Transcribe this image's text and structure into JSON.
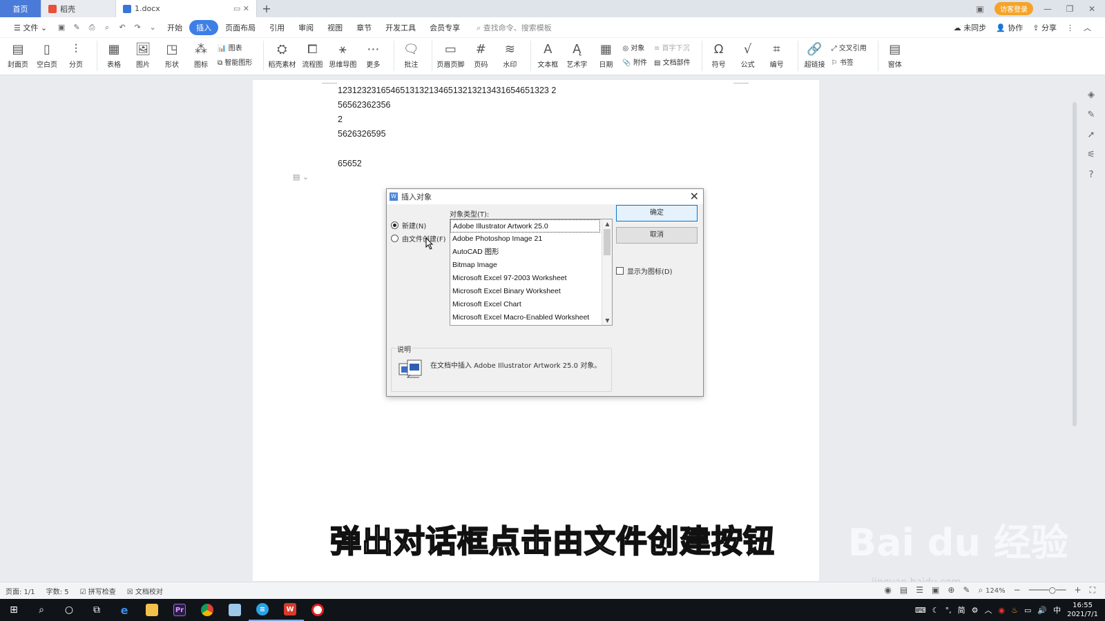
{
  "tabs": {
    "home": "首页",
    "straw": "稻壳",
    "doc": "1.docx"
  },
  "top_right": {
    "guest": "访客登录"
  },
  "menu": {
    "file": "文件",
    "items": [
      "开始",
      "插入",
      "页面布局",
      "引用",
      "审阅",
      "视图",
      "章节",
      "开发工具",
      "会员专享"
    ],
    "active": "插入",
    "search": "查找命令、搜索模板",
    "sync": "未同步",
    "collab": "协作",
    "share": "分享"
  },
  "ribbon": {
    "groups": [
      {
        "name": "cover",
        "label": "封面页"
      },
      {
        "name": "blank",
        "label": "空白页"
      },
      {
        "name": "break",
        "label": "分页"
      },
      {
        "name": "table",
        "label": "表格"
      },
      {
        "name": "picture",
        "label": "图片"
      },
      {
        "name": "shape",
        "label": "形状"
      },
      {
        "name": "icons",
        "label": "图标"
      }
    ],
    "chart": "图表",
    "smartart": "智能图形",
    "groups2": [
      {
        "name": "straw-material",
        "label": "稻壳素材"
      },
      {
        "name": "flowchart",
        "label": "流程图"
      },
      {
        "name": "mindmap",
        "label": "思维导图"
      },
      {
        "name": "more",
        "label": "更多"
      },
      {
        "name": "comment",
        "label": "批注"
      },
      {
        "name": "header-footer",
        "label": "页眉页脚"
      },
      {
        "name": "page-number",
        "label": "页码"
      },
      {
        "name": "watermark",
        "label": "水印"
      },
      {
        "name": "textbox",
        "label": "文本框"
      },
      {
        "name": "wordart",
        "label": "艺术字"
      },
      {
        "name": "date",
        "label": "日期"
      }
    ],
    "object": "对象",
    "attachment": "附件",
    "dropcap": "首字下沉",
    "docpart": "文档部件",
    "groups3": [
      {
        "name": "symbol",
        "label": "符号"
      },
      {
        "name": "formula",
        "label": "公式"
      },
      {
        "name": "numbering",
        "label": "编号"
      },
      {
        "name": "hyperlink",
        "label": "超链接"
      }
    ],
    "crossref": "交叉引用",
    "bookmark": "书签",
    "window": "窗体"
  },
  "document": {
    "lines": [
      "12312323165465131321346513213213431654651323 2",
      "56562362356",
      "2",
      "5626326595",
      "",
      "65652"
    ]
  },
  "dialog": {
    "title": "插入对象",
    "radio_new": "新建(N)",
    "radio_file": "由文件创建(F)",
    "object_type_label": "对象类型(T):",
    "items": [
      "Adobe Illustrator Artwork 25.0",
      "Adobe Photoshop Image 21",
      "AutoCAD 图形",
      "Bitmap Image",
      "Microsoft Excel 97-2003 Worksheet",
      "Microsoft Excel Binary Worksheet",
      "Microsoft Excel Chart",
      "Microsoft Excel Macro-Enabled Worksheet"
    ],
    "ok": "确定",
    "cancel": "取消",
    "display_as_icon": "显示为图标(D)",
    "desc_legend": "说明",
    "desc_text": "在文档中插入 Adobe Illustrator Artwork 25.0 对象。"
  },
  "caption": "弹出对话框点击由文件创建按钮",
  "watermark": {
    "main": "Bai  du 经验",
    "sub": "jingyan.baidu.com"
  },
  "status": {
    "page": "页面: 1/1",
    "words": "字数: 5",
    "spell": "拼写检查",
    "proof": "文档校对",
    "zoom": "124%"
  },
  "taskbar": {
    "ime1": "简",
    "ime2": "中",
    "time": "16:55",
    "date": "2021/7/1"
  },
  "colors": {
    "accent": "#3d7fe6",
    "home_tab": "#4b7bd9",
    "guest": "#f3a428"
  }
}
